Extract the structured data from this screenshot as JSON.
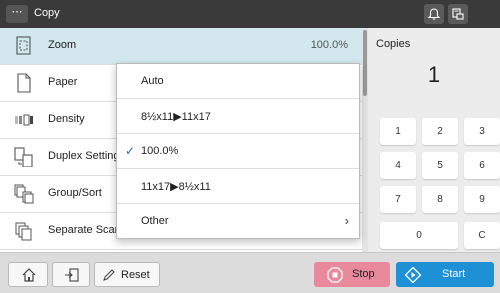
{
  "colors": {
    "active_row": "#d2e8ee",
    "stop": "#e98a9c",
    "start": "#1e90d6",
    "check": "#1e6ab8"
  },
  "header": {
    "menu_glyph": "⋯",
    "title": "Copy",
    "icons": [
      "bell-icon",
      "hdd-status-icon"
    ]
  },
  "settings": {
    "rows": [
      {
        "label": "Zoom",
        "value": "100.0%",
        "icon": "zoom-icon",
        "active": true
      },
      {
        "label": "Paper",
        "value": "",
        "icon": "paper-icon"
      },
      {
        "label": "Density",
        "value": "",
        "icon": "density-icon"
      },
      {
        "label": "Duplex Setting",
        "value": "",
        "icon": "duplex-icon"
      },
      {
        "label": "Group/Sort",
        "value": "",
        "icon": "group-sort-icon"
      },
      {
        "label": "Separate Scan",
        "value": "",
        "icon": "separate-scan-icon"
      }
    ]
  },
  "zoom_menu": {
    "options": [
      {
        "label": "Auto",
        "selected": false
      },
      {
        "label": "8½x11▶11x17",
        "selected": false
      },
      {
        "label": "100.0%",
        "selected": true
      },
      {
        "label": "11x17▶8½x11",
        "selected": false
      },
      {
        "label": "Other",
        "selected": false,
        "submenu": true
      }
    ],
    "check_glyph": "✓",
    "chevron_glyph": "›"
  },
  "copies": {
    "label": "Copies",
    "value": "1",
    "keypad": [
      "1",
      "2",
      "3",
      "4",
      "5",
      "6",
      "7",
      "8",
      "9",
      "0",
      "C"
    ]
  },
  "footer": {
    "reset_label": "Reset",
    "stop_label": "Stop",
    "start_label": "Start"
  }
}
